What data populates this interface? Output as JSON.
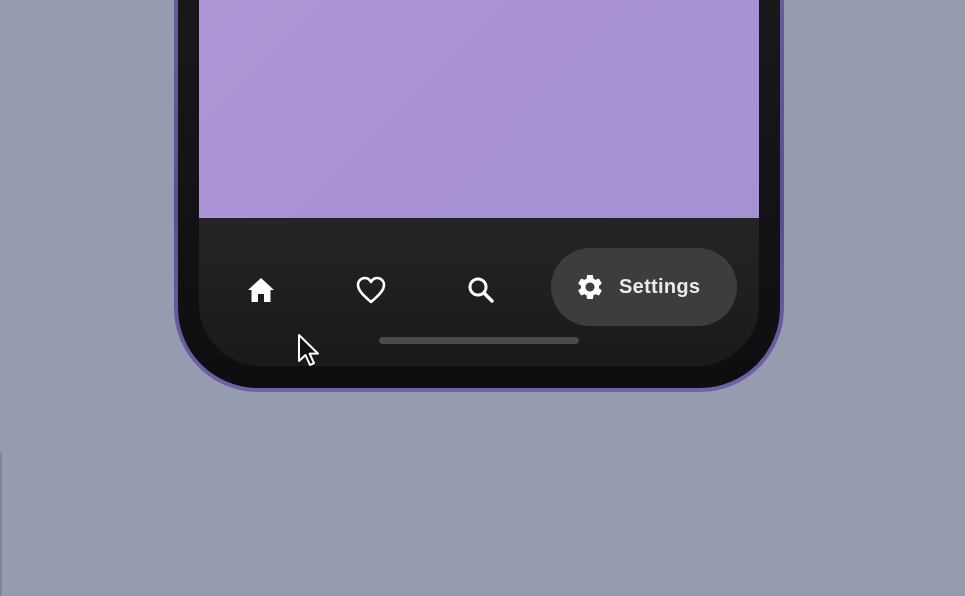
{
  "nav": {
    "items": [
      {
        "icon": "home-icon",
        "label": "",
        "active": false
      },
      {
        "icon": "heart-icon",
        "label": "",
        "active": false
      },
      {
        "icon": "search-icon",
        "label": "",
        "active": false
      },
      {
        "icon": "gear-icon",
        "label": "Settings",
        "active": true
      }
    ]
  },
  "colors": {
    "background": "#959cb0",
    "content": "#a994d5",
    "nav_bar": "#1e1e1f",
    "active_pill": "#3d3d3f",
    "phone_frame": "#5e5296",
    "icon": "#ffffff"
  }
}
